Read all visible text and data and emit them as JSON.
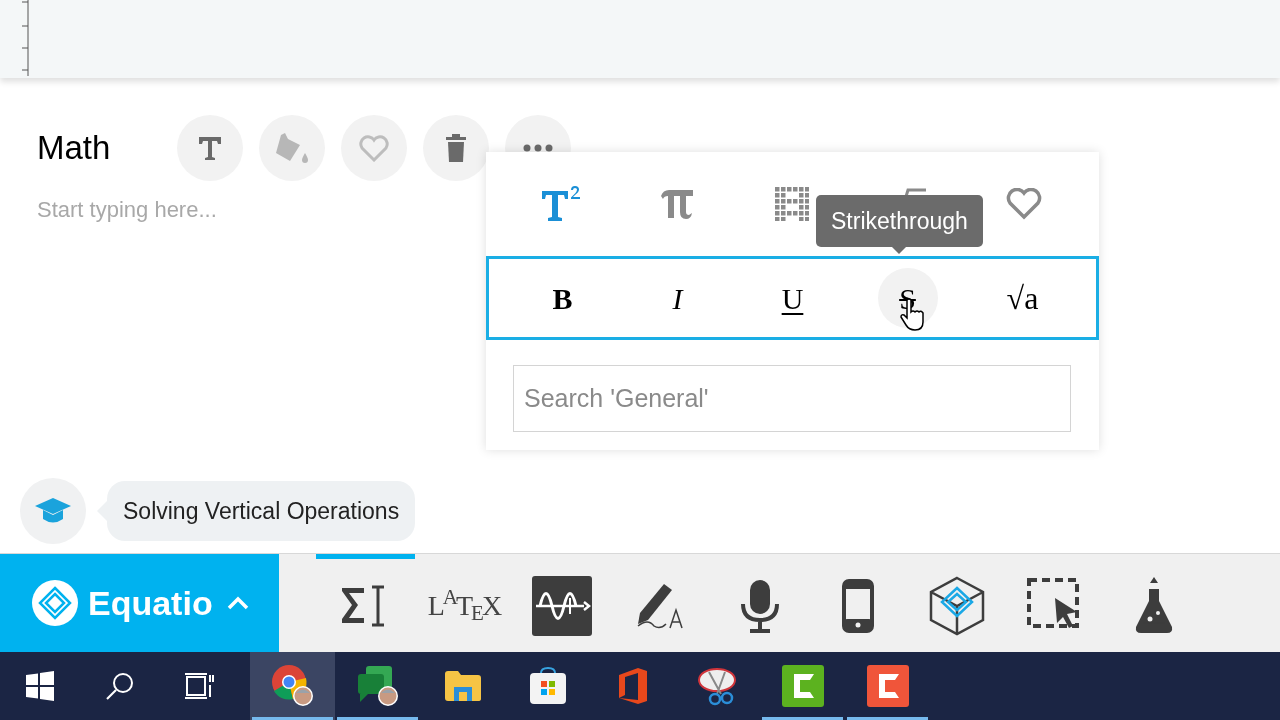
{
  "card": {
    "title": "Math",
    "placeholder": "Start typing here...",
    "actions": [
      {
        "kind": "text"
      },
      {
        "kind": "fill"
      },
      {
        "kind": "favorite"
      },
      {
        "kind": "delete"
      },
      {
        "kind": "more"
      }
    ]
  },
  "popup": {
    "categories": [
      {
        "kind": "superscript",
        "selected": true
      },
      {
        "kind": "pi",
        "selected": false
      },
      {
        "kind": "matrix",
        "selected": false
      },
      {
        "kind": "root",
        "selected": false
      },
      {
        "kind": "favorite",
        "selected": false
      }
    ],
    "format_buttons": [
      {
        "kind": "bold",
        "label": "B",
        "hovered": false
      },
      {
        "kind": "italic",
        "label": "I",
        "hovered": false
      },
      {
        "kind": "underline",
        "label": "U",
        "hovered": false
      },
      {
        "kind": "strike",
        "label": "S",
        "hovered": true
      },
      {
        "kind": "root",
        "label": "√a",
        "hovered": false
      }
    ],
    "tooltip": "Strikethrough",
    "search": {
      "placeholder": "Search 'General'"
    }
  },
  "hint": {
    "text": "Solving Vertical Operations"
  },
  "equatio": {
    "label": "Equatio"
  },
  "toolbar": [
    {
      "kind": "equation",
      "selected": true
    },
    {
      "kind": "latex",
      "label": "L$^{A}$T$_{E}$X",
      "selected": false
    },
    {
      "kind": "graph",
      "selected": false
    },
    {
      "kind": "handwriting",
      "selected": false
    },
    {
      "kind": "speech",
      "selected": false
    },
    {
      "kind": "mobile",
      "selected": false
    },
    {
      "kind": "space",
      "selected": false
    },
    {
      "kind": "screenshot",
      "selected": false
    },
    {
      "kind": "stem",
      "selected": false
    }
  ],
  "taskbar": [
    {
      "kind": "start",
      "active": false,
      "running": false
    },
    {
      "kind": "search",
      "active": false,
      "running": false
    },
    {
      "kind": "taskview",
      "active": false,
      "running": false
    },
    {
      "kind": "chrome",
      "active": true,
      "running": true
    },
    {
      "kind": "chat",
      "active": false,
      "running": true
    },
    {
      "kind": "explorer",
      "active": false,
      "running": false
    },
    {
      "kind": "store",
      "active": false,
      "running": false
    },
    {
      "kind": "office",
      "active": false,
      "running": false
    },
    {
      "kind": "snip",
      "active": false,
      "running": false
    },
    {
      "kind": "camtasia",
      "active": false,
      "running": true
    },
    {
      "kind": "recorder",
      "active": false,
      "running": true
    }
  ]
}
